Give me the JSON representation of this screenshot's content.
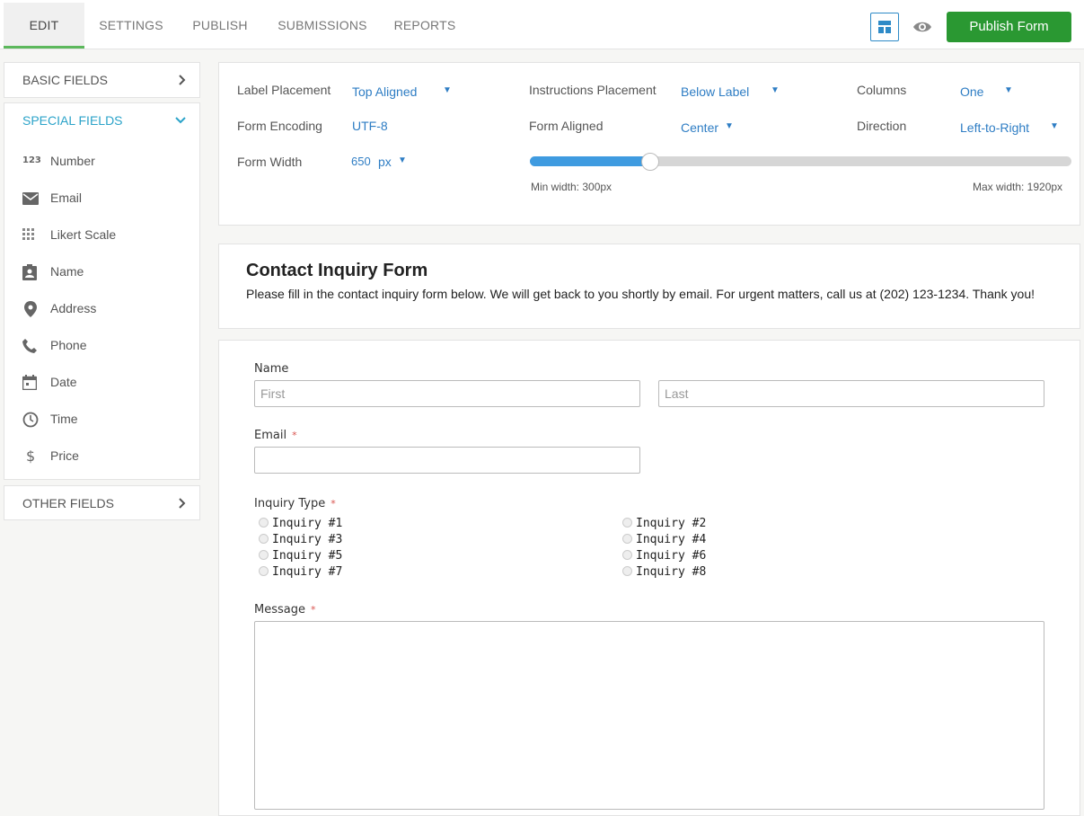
{
  "tabs": [
    {
      "label": "EDIT",
      "active": true
    },
    {
      "label": "SETTINGS",
      "active": false
    },
    {
      "label": "PUBLISH",
      "active": false
    },
    {
      "label": "SUBMISSIONS",
      "active": false
    },
    {
      "label": "REPORTS",
      "active": false
    }
  ],
  "header": {
    "publish_label": "Publish Form",
    "publish_color": "#2a9832",
    "accent_color": "#2e8ac7"
  },
  "sidebar": {
    "basic": {
      "label": "BASIC FIELDS"
    },
    "special": {
      "label": "SPECIAL FIELDS",
      "items": [
        {
          "label": "Number",
          "icon": "number-icon"
        },
        {
          "label": "Email",
          "icon": "envelope-icon"
        },
        {
          "label": "Likert Scale",
          "icon": "grid-icon"
        },
        {
          "label": "Name",
          "icon": "contact-card-icon"
        },
        {
          "label": "Address",
          "icon": "map-pin-icon"
        },
        {
          "label": "Phone",
          "icon": "phone-icon"
        },
        {
          "label": "Date",
          "icon": "calendar-icon"
        },
        {
          "label": "Time",
          "icon": "clock-icon"
        },
        {
          "label": "Price",
          "icon": "dollar-icon"
        }
      ]
    },
    "other": {
      "label": "OTHER FIELDS"
    }
  },
  "settings": {
    "label_placement": {
      "label": "Label Placement",
      "value": "Top Aligned"
    },
    "instructions_placement": {
      "label": "Instructions Placement",
      "value": "Below Label"
    },
    "columns": {
      "label": "Columns",
      "value": "One"
    },
    "form_encoding": {
      "label": "Form Encoding",
      "value": "UTF-8"
    },
    "form_aligned": {
      "label": "Form Aligned",
      "value": "Center"
    },
    "direction": {
      "label": "Direction",
      "value": "Left-to-Right"
    },
    "form_width": {
      "label": "Form Width",
      "value": "650",
      "unit": "px"
    },
    "slider": {
      "min_label": "Min width: 300px",
      "max_label": "Max width: 1920px",
      "min": 300,
      "max": 1920,
      "value": 650
    }
  },
  "form": {
    "title": "Contact Inquiry Form",
    "description": "Please fill in the contact inquiry form below. We will get back to you shortly by email. For urgent matters, call us at (202) 123-1234. Thank you!",
    "name_label": "Name",
    "first_placeholder": "First",
    "last_placeholder": "Last",
    "email_label": "Email",
    "inquiry_label": "Inquiry Type",
    "inquiry_options": [
      "Inquiry #1",
      "Inquiry #2",
      "Inquiry #3",
      "Inquiry #4",
      "Inquiry #5",
      "Inquiry #6",
      "Inquiry #7",
      "Inquiry #8"
    ],
    "message_label": "Message",
    "required_mark": "*"
  }
}
